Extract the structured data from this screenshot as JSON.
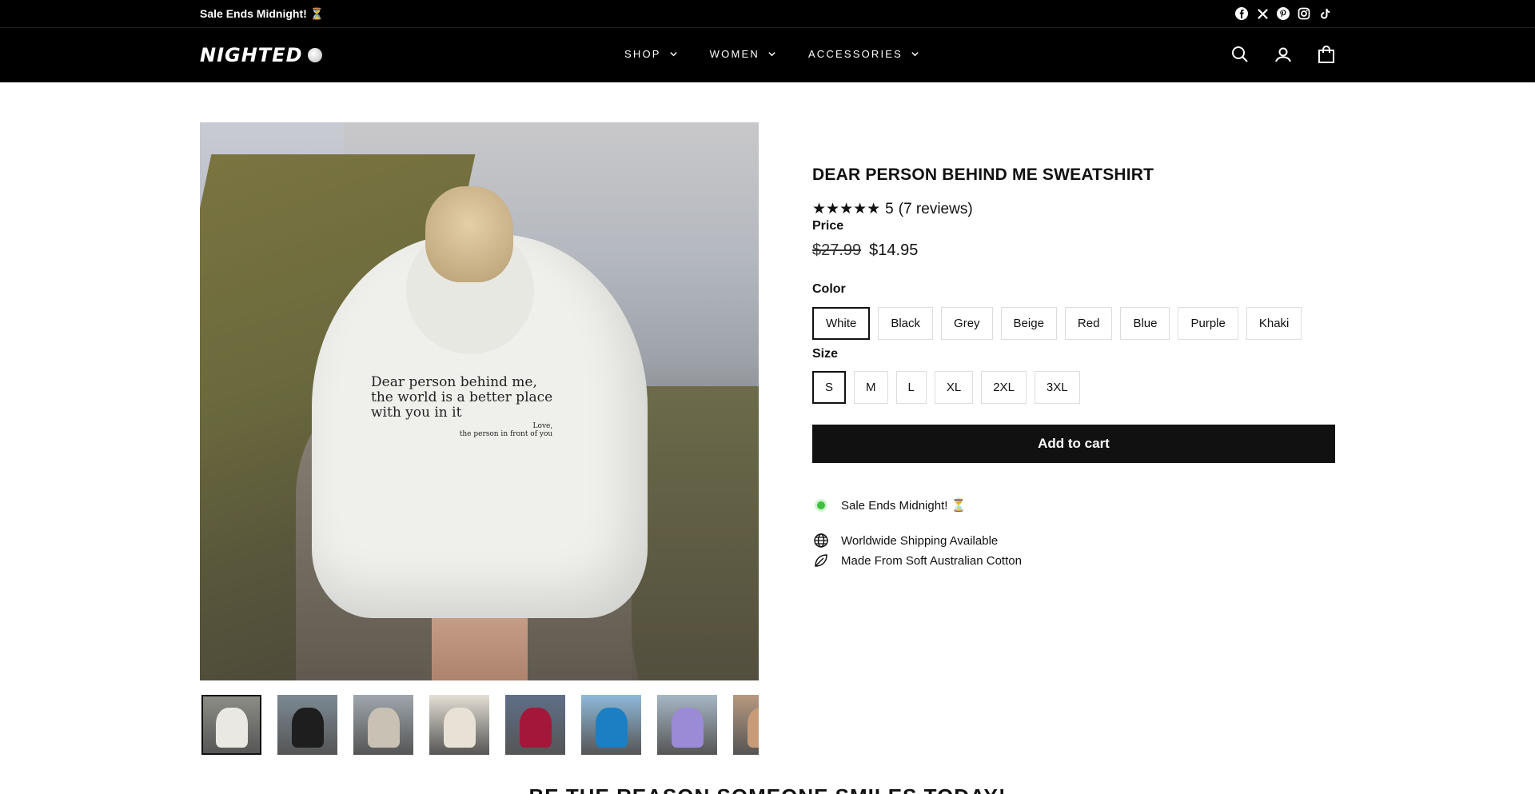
{
  "announcement": {
    "text": "Sale Ends Midnight! ⏳"
  },
  "socials": [
    "facebook-icon",
    "x-icon",
    "pinterest-icon",
    "instagram-icon",
    "tiktok-icon"
  ],
  "header": {
    "logo": "NIGHTED",
    "nav": [
      {
        "label": "SHOP"
      },
      {
        "label": "WOMEN"
      },
      {
        "label": "ACCESSORIES"
      }
    ],
    "icons": [
      "search-icon",
      "account-icon",
      "cart-icon"
    ]
  },
  "gallery": {
    "print_lines": [
      "Dear person behind me,",
      "the world is a better place",
      "with you in it"
    ],
    "print_love": "Love,",
    "print_signature": "the person in front of you",
    "thumbnail_colors": [
      "#e9e8e2",
      "#1e1e1e",
      "#c9c1b3",
      "#e8e2d6",
      "#a3183a",
      "#1c7fc4",
      "#9b8ad6",
      "#c79a78"
    ]
  },
  "product": {
    "title": "DEAR PERSON BEHIND ME SWEATSHIRT",
    "stars": "★★★★★",
    "rating": "5",
    "reviews": "(7 reviews)",
    "price_label": "Price",
    "price_old": "$27.99",
    "price_new": "$14.95",
    "color_label": "Color",
    "colors": [
      "White",
      "Black",
      "Grey",
      "Beige",
      "Red",
      "Blue",
      "Purple",
      "Khaki"
    ],
    "selected_color": "White",
    "size_label": "Size",
    "sizes": [
      "S",
      "M",
      "L",
      "XL",
      "2XL",
      "3XL"
    ],
    "selected_size": "S",
    "add_to_cart": "Add to cart",
    "features": {
      "sale": "Sale Ends Midnight! ⏳",
      "shipping": "Worldwide Shipping Available",
      "cotton": "Made From Soft Australian Cotton"
    }
  },
  "bottom_heading": "BE THE REASON SOMEONE SMILES TODAY!",
  "colors": {
    "accent": "#111111",
    "status_dot": "#3cc33c"
  }
}
